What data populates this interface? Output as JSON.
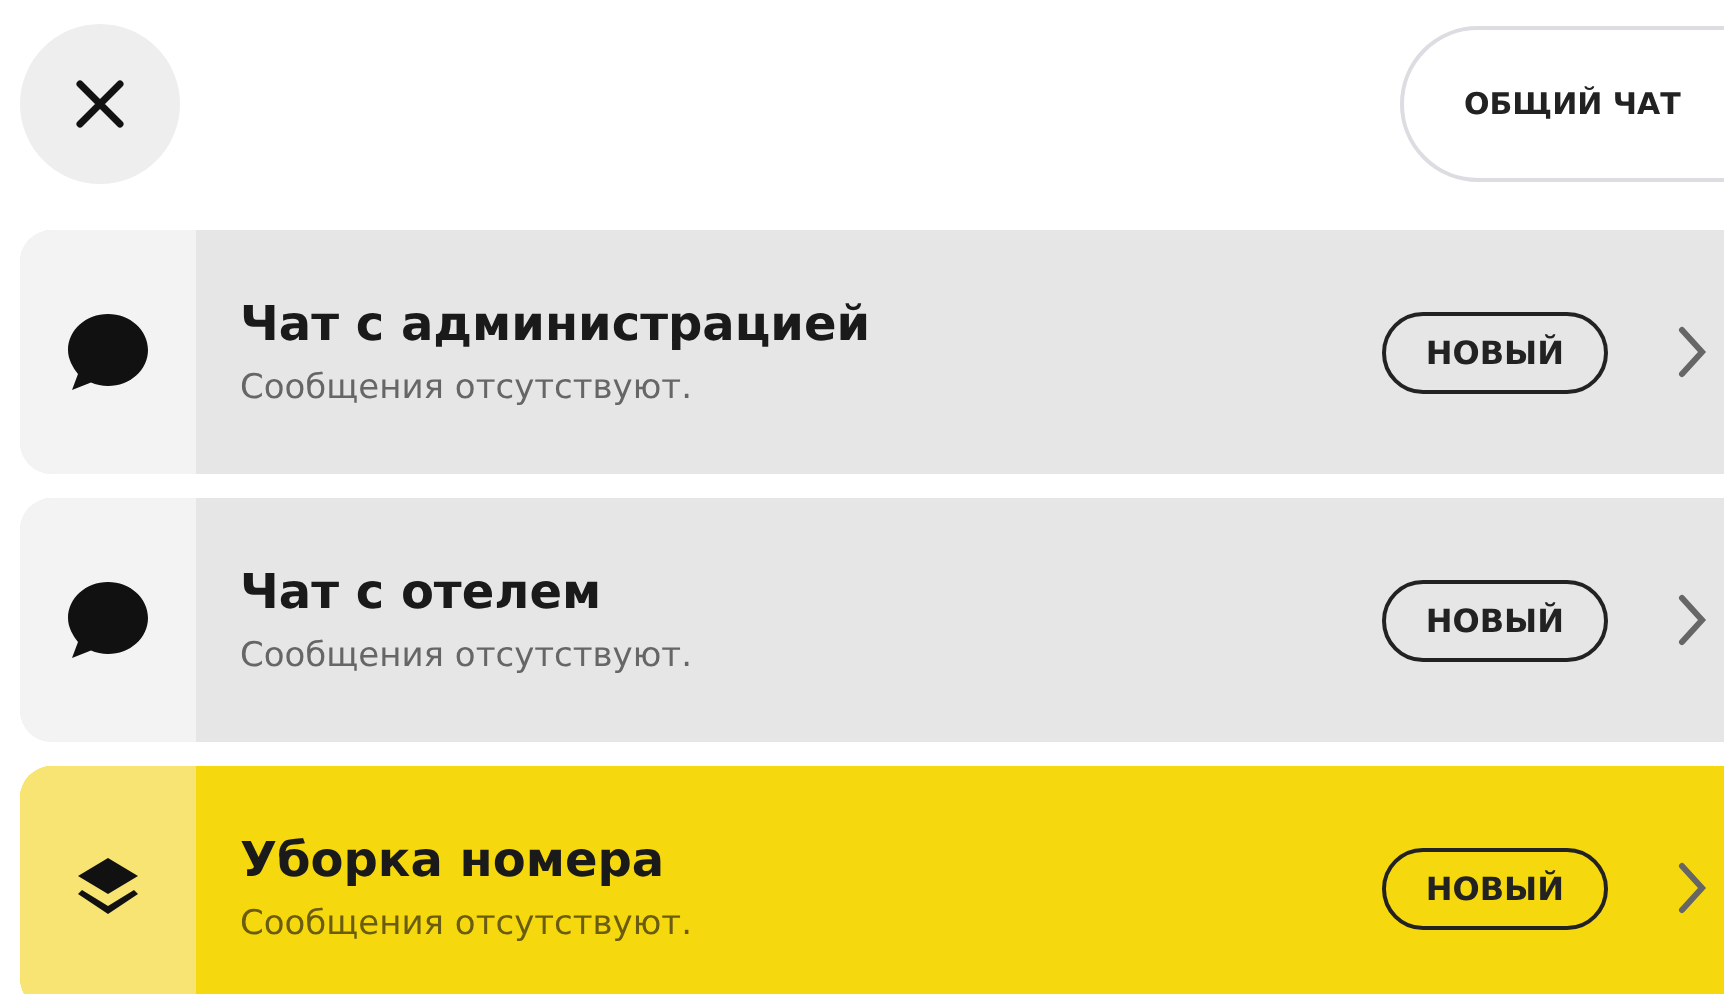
{
  "header": {
    "general_chat_button": "ОБЩИЙ ЧАТ"
  },
  "chats": [
    {
      "kind": "chat",
      "title": "Чат с администрацией",
      "subtitle": "Сообщения отсутствуют.",
      "badge": "НОВЫЙ"
    },
    {
      "kind": "chat",
      "title": "Чат с отелем",
      "subtitle": "Сообщения отсутствуют.",
      "badge": "НОВЫЙ"
    },
    {
      "kind": "service",
      "title": "Уборка номера",
      "subtitle": "Сообщения отсутствуют.",
      "badge": "НОВЫЙ"
    }
  ]
}
